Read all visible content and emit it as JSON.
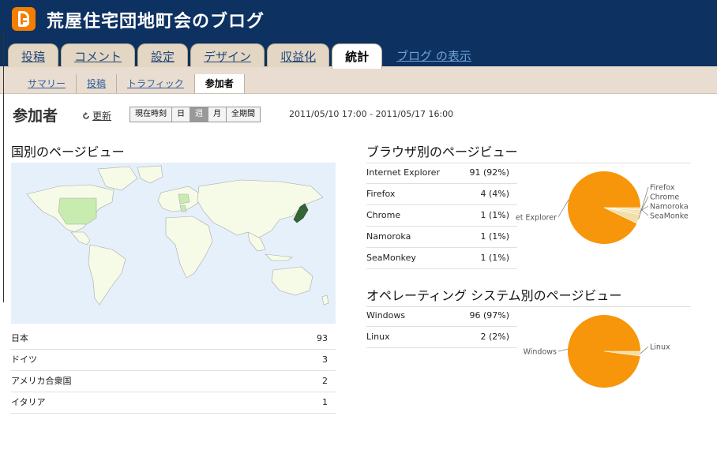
{
  "header": {
    "blog_title": "荒屋住宅団地町会のブログ",
    "tabs": [
      {
        "label": "投稿"
      },
      {
        "label": "コメント"
      },
      {
        "label": "設定"
      },
      {
        "label": "デザイン"
      },
      {
        "label": "収益化"
      },
      {
        "label": "統計",
        "active": true
      }
    ],
    "view_blog_link": "ブログ の表示"
  },
  "subtabs": [
    {
      "label": "サマリー"
    },
    {
      "label": "投稿"
    },
    {
      "label": "トラフィック"
    },
    {
      "label": "参加者",
      "active": true
    }
  ],
  "page": {
    "title": "参加者",
    "refresh_label": "更新",
    "range_buttons": [
      "現在時刻",
      "日",
      "週",
      "月",
      "全期間"
    ],
    "active_range": "週",
    "date_range": "2011/05/10 17:00 - 2011/05/17 16:00"
  },
  "country": {
    "title": "国別のページビュー",
    "rows": [
      {
        "name": "日本",
        "value": "93"
      },
      {
        "name": "ドイツ",
        "value": "3"
      },
      {
        "name": "アメリカ合衆国",
        "value": "2"
      },
      {
        "name": "イタリア",
        "value": "1"
      }
    ]
  },
  "browser": {
    "title": "ブラウザ別のページビュー",
    "rows": [
      {
        "name": "Internet Explorer",
        "value": "91 (92%)"
      },
      {
        "name": "Firefox",
        "value": "4 (4%)"
      },
      {
        "name": "Chrome",
        "value": "1 (1%)"
      },
      {
        "name": "Namoroka",
        "value": "1 (1%)"
      },
      {
        "name": "SeaMonkey",
        "value": "1 (1%)"
      }
    ],
    "pie_labels": [
      "et Explorer",
      "Firefox",
      "Chrome",
      "Namoroka",
      "SeaMonke"
    ]
  },
  "os": {
    "title": "オペレーティング システム別のページビュー",
    "rows": [
      {
        "name": "Windows",
        "value": "96 (97%)"
      },
      {
        "name": "Linux",
        "value": "2 (2%)"
      }
    ],
    "pie_labels": [
      "Windows",
      "Linux"
    ]
  },
  "chart_data": [
    {
      "type": "pie",
      "categories": [
        "Internet Explorer",
        "Firefox",
        "Chrome",
        "Namoroka",
        "SeaMonkey"
      ],
      "values": [
        91,
        4,
        1,
        1,
        1
      ],
      "title": "ブラウザ別のページビュー"
    },
    {
      "type": "pie",
      "categories": [
        "Windows",
        "Linux"
      ],
      "values": [
        96,
        2
      ],
      "title": "オペレーティング システム別のページビュー"
    }
  ],
  "colors": {
    "header_bg": "#0d3160",
    "tab_bg": "#e3d7c4",
    "pie_main": "#f7960a",
    "pie_minor": "#f2dfa6",
    "map_water": "#e6f0fa",
    "map_land": "#f5fbe6",
    "map_hot": "#336633",
    "map_mid": "#c8ecb0"
  }
}
